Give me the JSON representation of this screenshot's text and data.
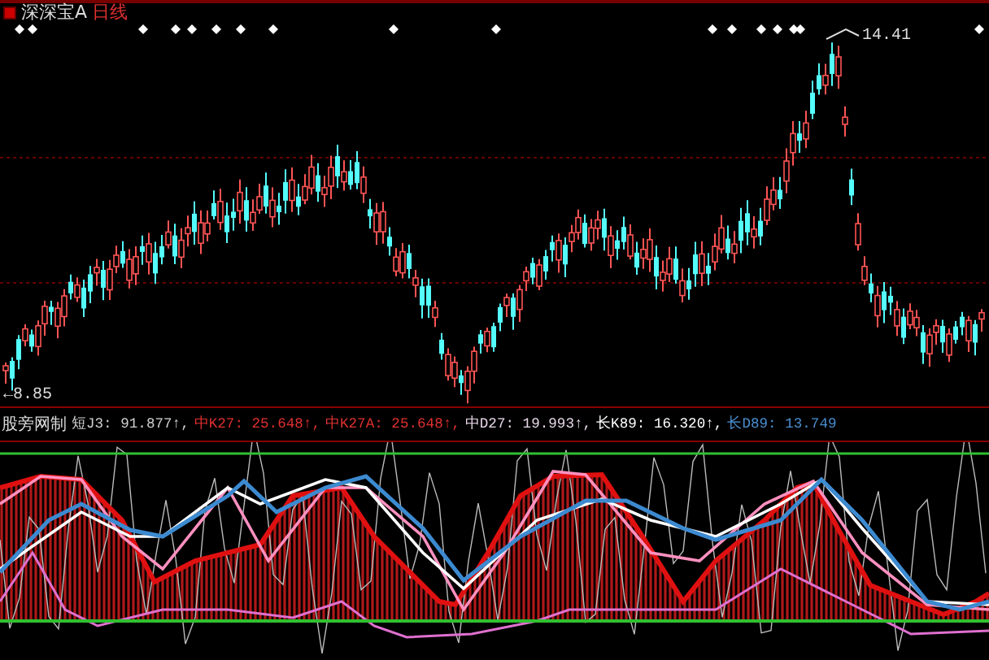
{
  "title_bar": {
    "stock_name": "深深宝A",
    "period": "日线"
  },
  "price_chart": {
    "high_label": "14.41",
    "low_label": "←8.85"
  },
  "indicator": {
    "name": "股旁网制",
    "readings": [
      {
        "label": "短J3: 91.877↑,",
        "color": "#d0d0d0"
      },
      {
        "label": "中K27: 25.648↑,",
        "color": "#e03030"
      },
      {
        "label": "中K27A: 25.648↑,",
        "color": "#e03030"
      },
      {
        "label": "中D27: 19.993↑,",
        "color": "#e8d8e8"
      },
      {
        "label": "长K89: 16.320↑,",
        "color": "#ffffff"
      },
      {
        "label": "长D89: 13.749",
        "color": "#4a8fd0"
      }
    ]
  }
}
